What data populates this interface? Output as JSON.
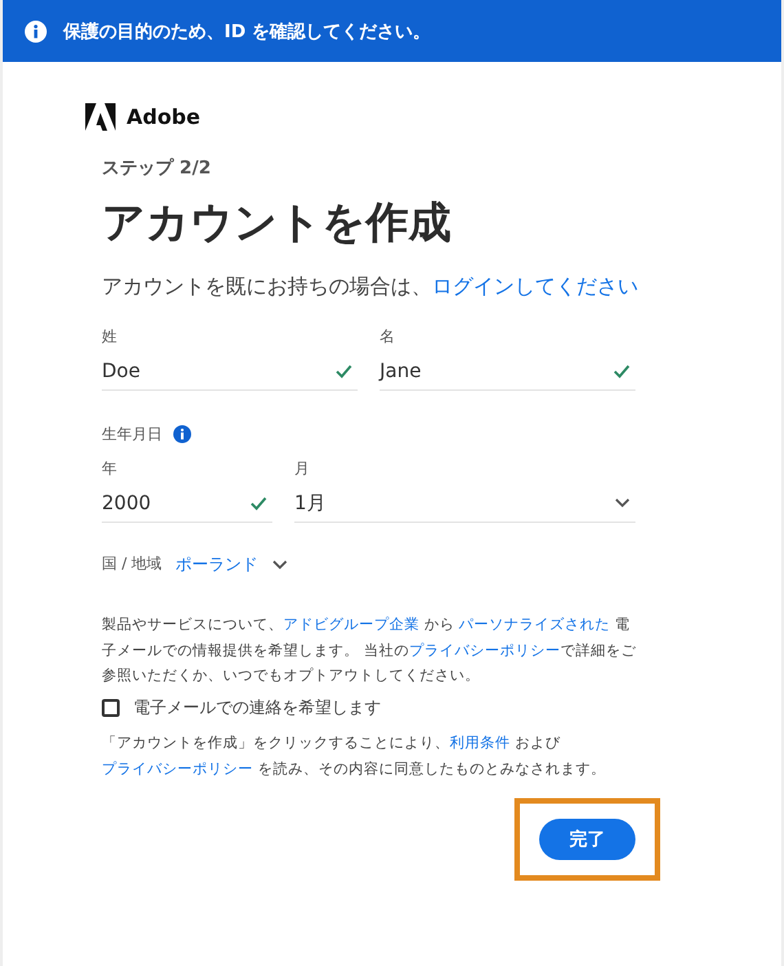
{
  "banner": {
    "text": "保護の目的のため、ID を確認してください。"
  },
  "brand": {
    "name": "Adobe"
  },
  "step": "ステップ 2/2",
  "title": "アカウントを作成",
  "intro": [
    {
      "text": "アカウントを既にお持ちの場合は、",
      "link": false
    },
    {
      "text": "ログインしてください",
      "link": true
    }
  ],
  "name_fields": [
    {
      "label": "姓",
      "value": "Doe",
      "valid": true
    },
    {
      "label": "名",
      "value": "Jane",
      "valid": true
    }
  ],
  "birth": {
    "label": "生年月日",
    "fields": [
      {
        "kind": "input",
        "label": "年",
        "value": "2000",
        "valid": true
      },
      {
        "kind": "select",
        "label": "月",
        "value": "1月"
      }
    ]
  },
  "country": {
    "label": "国 / 地域",
    "value": "ポーランド"
  },
  "marketing": [
    {
      "text": "製品やサービスについて、",
      "link": false
    },
    {
      "text": "アドビグループ企業",
      "link": true
    },
    {
      "text": " から ",
      "link": false
    },
    {
      "text": "パーソナライズされた",
      "link": true
    },
    {
      "text": " 電子メールでの情報提供を希望します。 当社の",
      "link": false
    },
    {
      "text": "プライバシーポリシー",
      "link": true
    },
    {
      "text": "で詳細をご参照いただくか、いつでもオプトアウトしてください。",
      "link": false
    }
  ],
  "email_opt_in": {
    "label": "電子メールでの連絡を希望します",
    "checked": false
  },
  "terms": [
    {
      "text": "「アカウントを作成」をクリックすることにより、",
      "link": false
    },
    {
      "text": "利用条件",
      "link": true
    },
    {
      "text": " および ",
      "link": false
    },
    {
      "text": "プライバシーポリシー",
      "link": true
    },
    {
      "text": " を読み、その内容に同意したものとみなされます。",
      "link": false
    }
  ],
  "submit": {
    "label": "完了",
    "highlighted": true
  }
}
